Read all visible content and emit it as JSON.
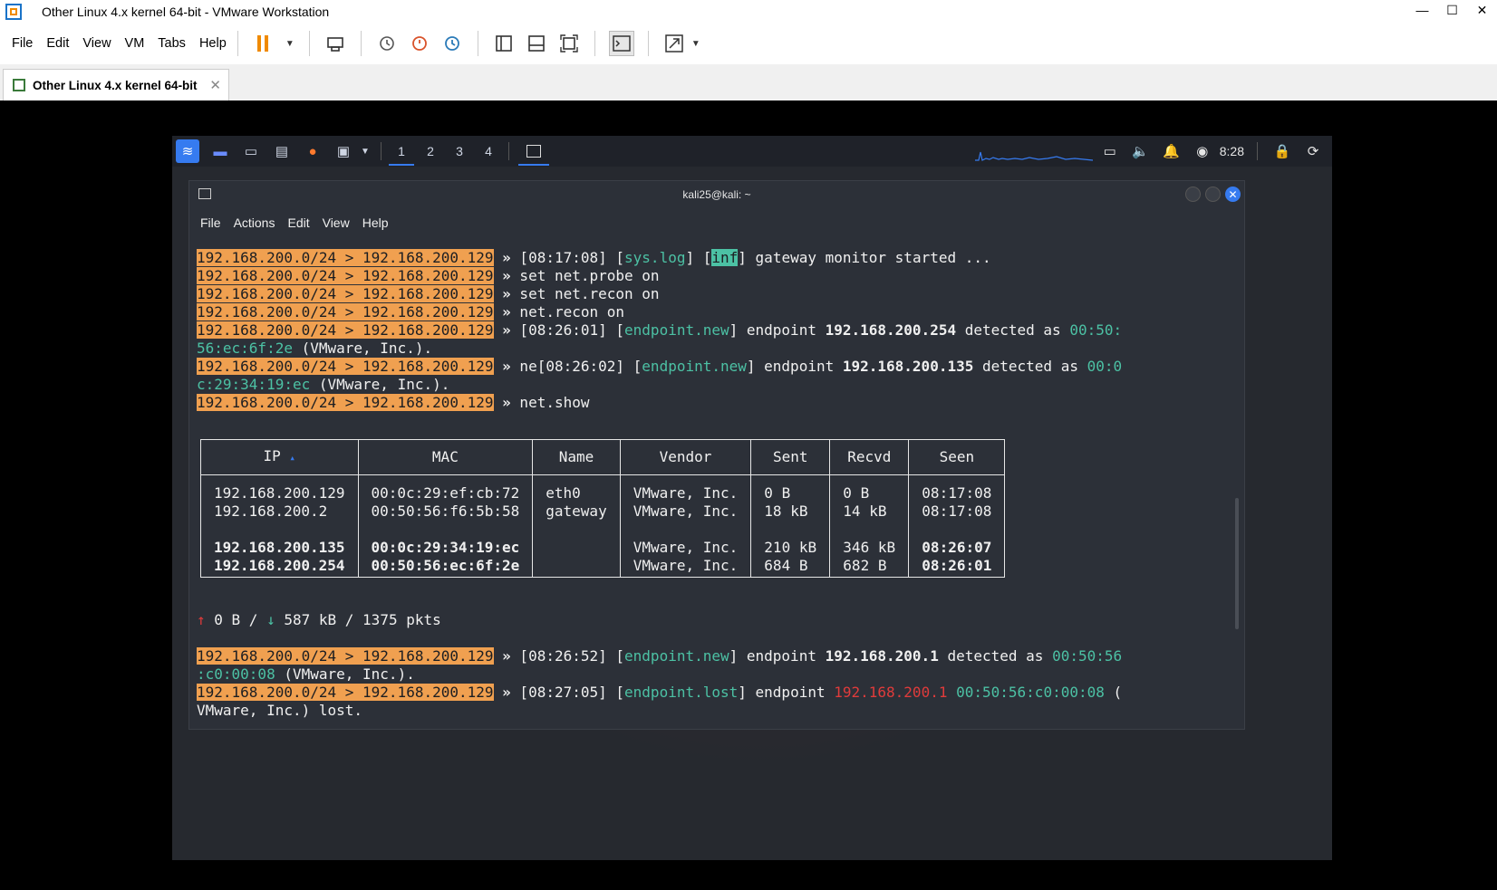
{
  "window": {
    "title": "Other Linux 4.x kernel 64-bit - VMware Workstation"
  },
  "menu": [
    "File",
    "Edit",
    "View",
    "VM",
    "Tabs",
    "Help"
  ],
  "tab": {
    "label": "Other Linux 4.x kernel 64-bit"
  },
  "guest_panel": {
    "workspaces": [
      "1",
      "2",
      "3",
      "4"
    ],
    "clock": "8:28"
  },
  "terminal": {
    "title": "kali25@kali: ~",
    "menu": [
      "File",
      "Actions",
      "Edit",
      "View",
      "Help"
    ],
    "prompt": "192.168.200.0/24 > 192.168.200.129",
    "arrow": "»",
    "lines": {
      "l1_a": " [08:17:08] [",
      "l1_tag": "sys.log",
      "l1_b": "] [",
      "l1_inf": "inf",
      "l1_c": "] gateway monitor started ...",
      "l2": " set net.probe on",
      "l3": " set net.recon on",
      "l4": " net.recon on",
      "l5_a": " [08:26:01] [",
      "l5_tag": "endpoint.new",
      "l5_b": "] endpoint ",
      "l5_ip": "192.168.200.254",
      "l5_c": " detected as ",
      "l5_mac1": "00:50:",
      "l6_mac2": "56:ec:6f:2e",
      "l6_rest": " (VMware, Inc.).",
      "l7_a": " ne[08:26:02] [",
      "l7_tag": "endpoint.new",
      "l7_b": "] endpoint ",
      "l7_ip": "192.168.200.135",
      "l7_c": " detected as ",
      "l7_mac1": "00:0",
      "l8_mac2": "c:29:34:19:ec",
      "l8_rest": " (VMware, Inc.).",
      "l9": " net.show",
      "stats_up_arrow": "↑",
      "stats_up": " 0 B / ",
      "stats_down_arrow": "↓",
      "stats_down": " 587 kB / 1375 pkts",
      "l10_a": " [08:26:52] [",
      "l10_tag": "endpoint.new",
      "l10_b": "] endpoint ",
      "l10_ip": "192.168.200.1",
      "l10_c": " detected as ",
      "l10_mac1": "00:50:56",
      "l11_mac2": ":c0:00:08",
      "l11_rest": " (VMware, Inc.).",
      "l12_a": " [08:27:05] [",
      "l12_tag": "endpoint.lost",
      "l12_b": "] endpoint ",
      "l12_ip": "192.168.200.1",
      "l12_sp": " ",
      "l12_mac": "00:50:56:c0:00:08",
      "l12_c": " (",
      "l13": "VMware, Inc.) lost."
    },
    "table": {
      "headers": [
        "IP",
        "MAC",
        "Name",
        "Vendor",
        "Sent",
        "Recvd",
        "Seen"
      ],
      "sort_indicator": "▴",
      "rows": [
        [
          "192.168.200.129",
          "00:0c:29:ef:cb:72",
          "eth0",
          "VMware, Inc.",
          "0 B",
          "0 B",
          "08:17:08"
        ],
        [
          "192.168.200.2",
          "00:50:56:f6:5b:58",
          "gateway",
          "VMware, Inc.",
          "18 kB",
          "14 kB",
          "08:17:08"
        ],
        [
          "192.168.200.135",
          "00:0c:29:34:19:ec",
          "",
          "VMware, Inc.",
          "210 kB",
          "346 kB",
          "08:26:07"
        ],
        [
          "192.168.200.254",
          "00:50:56:ec:6f:2e",
          "",
          "VMware, Inc.",
          "684 B",
          "682 B",
          "08:26:01"
        ]
      ]
    }
  },
  "colors": {
    "prompt_bg": "#f0a050",
    "accent_green": "#4cc1a4",
    "error_red": "#e03b3b",
    "kali_blue": "#367bf0"
  }
}
